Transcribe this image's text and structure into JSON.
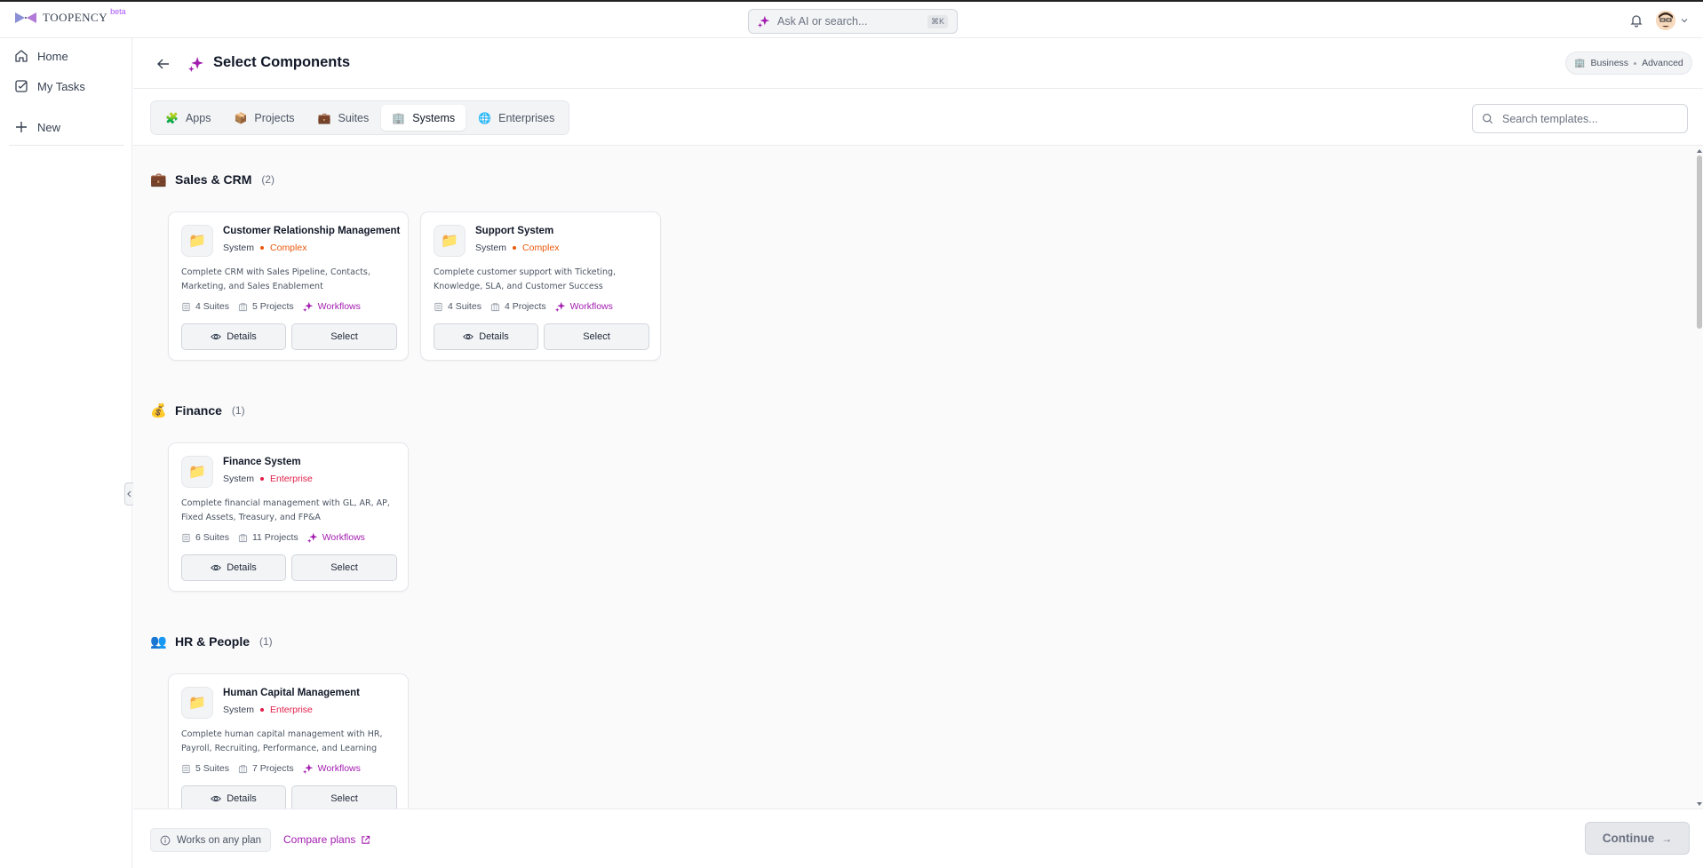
{
  "app": {
    "logo_text": "TOOPENCY",
    "beta_label": "beta",
    "search_placeholder": "Ask AI or search...",
    "search_shortcut": "⌘K"
  },
  "sidebar": {
    "items": [
      {
        "label": "Home",
        "icon": "home-icon"
      },
      {
        "label": "My Tasks",
        "icon": "tasks-icon"
      },
      {
        "label": "New",
        "icon": "plus-icon"
      }
    ]
  },
  "header": {
    "title": "Select Components",
    "plan": {
      "tier": "Business",
      "level": "Advanced"
    }
  },
  "tabs": [
    {
      "label": "Apps",
      "emoji": "🧩",
      "active": false
    },
    {
      "label": "Projects",
      "emoji": "📦",
      "active": false
    },
    {
      "label": "Suites",
      "emoji": "💼",
      "active": false
    },
    {
      "label": "Systems",
      "emoji": "🏢",
      "active": true
    },
    {
      "label": "Enterprises",
      "emoji": "🌐",
      "active": false
    }
  ],
  "template_search": {
    "placeholder": "Search templates..."
  },
  "sections": [
    {
      "emoji": "💼",
      "name": "Sales & CRM",
      "count": "(2)",
      "cards": [
        {
          "icon": "📁",
          "title": "Customer Relationship Management",
          "type": "System",
          "complexity": "Complex",
          "complexity_color": "#ea580c",
          "description": "Complete CRM with Sales Pipeline, Contacts, Marketing, and Sales Enablement",
          "suites": "4 Suites",
          "projects": "5 Projects",
          "workflows": "Workflows",
          "details_label": "Details",
          "select_label": "Select"
        },
        {
          "icon": "📁",
          "title": "Support System",
          "type": "System",
          "complexity": "Complex",
          "complexity_color": "#ea580c",
          "description": "Complete customer support with Ticketing, Knowledge, SLA, and Customer Success",
          "suites": "4 Suites",
          "projects": "4 Projects",
          "workflows": "Workflows",
          "details_label": "Details",
          "select_label": "Select"
        }
      ]
    },
    {
      "emoji": "💰",
      "name": "Finance",
      "count": "(1)",
      "cards": [
        {
          "icon": "📁",
          "title": "Finance System",
          "type": "System",
          "complexity": "Enterprise",
          "complexity_color": "#e11d48",
          "description": "Complete financial management with GL, AR, AP, Fixed Assets, Treasury, and FP&A",
          "suites": "6 Suites",
          "projects": "11 Projects",
          "workflows": "Workflows",
          "details_label": "Details",
          "select_label": "Select"
        }
      ]
    },
    {
      "emoji": "👥",
      "name": "HR & People",
      "count": "(1)",
      "cards": [
        {
          "icon": "📁",
          "title": "Human Capital Management",
          "type": "System",
          "complexity": "Enterprise",
          "complexity_color": "#e11d48",
          "description": "Complete human capital management with HR, Payroll, Recruiting, Performance, and Learning",
          "suites": "5 Suites",
          "projects": "7 Projects",
          "workflows": "Workflows",
          "details_label": "Details",
          "select_label": "Select"
        }
      ]
    }
  ],
  "footer": {
    "works_label": "Works on any plan",
    "compare_label": "Compare plans",
    "continue_label": "Continue",
    "continue_arrow": "→"
  },
  "colors": {
    "accent": "#a21caf",
    "complex": "#ea580c",
    "enterprise": "#e11d48"
  }
}
